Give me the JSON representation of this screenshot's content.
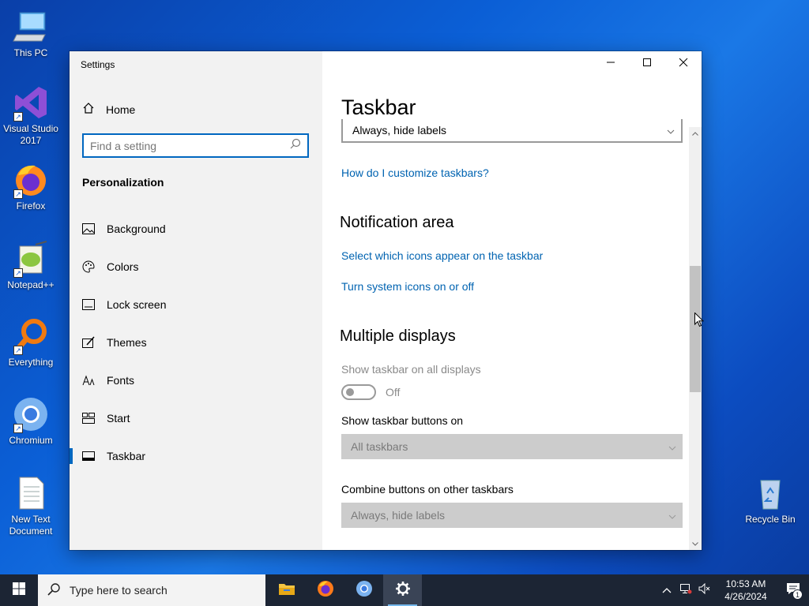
{
  "desktop": {
    "icons": [
      {
        "label": "This PC"
      },
      {
        "label": "Visual Studio 2017"
      },
      {
        "label": "Firefox"
      },
      {
        "label": "Notepad++"
      },
      {
        "label": "Everything"
      },
      {
        "label": "Chromium"
      },
      {
        "label": "New Text Document"
      },
      {
        "label": "Recycle Bin"
      }
    ]
  },
  "window": {
    "title": "Settings",
    "controls": {
      "minimize": "minimize-icon",
      "maximize": "maximize-icon",
      "close": "close-icon"
    }
  },
  "sidebar": {
    "home": "Home",
    "search_placeholder": "Find a setting",
    "section": "Personalization",
    "items": [
      {
        "label": "Background",
        "icon": "image-icon"
      },
      {
        "label": "Colors",
        "icon": "palette-icon"
      },
      {
        "label": "Lock screen",
        "icon": "lock-screen-icon"
      },
      {
        "label": "Themes",
        "icon": "themes-icon"
      },
      {
        "label": "Fonts",
        "icon": "fonts-icon"
      },
      {
        "label": "Start",
        "icon": "start-icon"
      },
      {
        "label": "Taskbar",
        "icon": "taskbar-icon",
        "active": true
      }
    ]
  },
  "content": {
    "title": "Taskbar",
    "combine_top_value": "Always, hide labels",
    "customize_link": "How do I customize taskbars?",
    "notification_heading": "Notification area",
    "notification_links": [
      "Select which icons appear on the taskbar",
      "Turn system icons on or off"
    ],
    "multiple_heading": "Multiple displays",
    "show_all_label": "Show taskbar on all displays",
    "show_all_state": "Off",
    "buttons_on_label": "Show taskbar buttons on",
    "buttons_on_value": "All taskbars",
    "combine_other_label": "Combine buttons on other taskbars",
    "combine_other_value": "Always, hide labels"
  },
  "taskbar": {
    "search_placeholder": "Type here to search",
    "time": "10:53 AM",
    "date": "4/26/2024",
    "notification_count": "1",
    "accent": "#76b9ed"
  }
}
